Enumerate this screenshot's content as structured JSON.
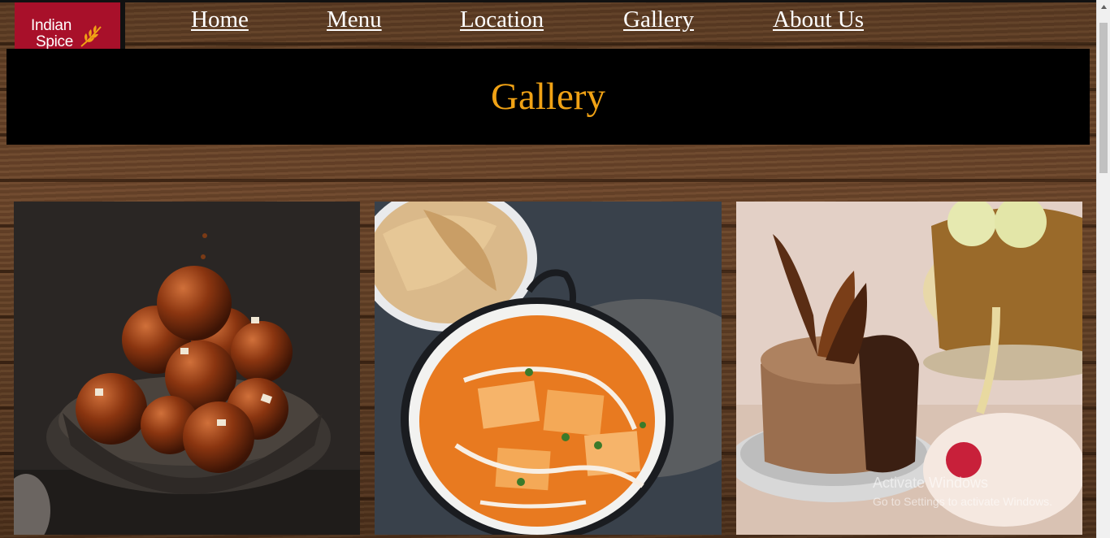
{
  "logo": {
    "line1": "Indian",
    "line2": "Spice"
  },
  "nav": {
    "items": [
      {
        "label": "Home"
      },
      {
        "label": "Menu"
      },
      {
        "label": "Location"
      },
      {
        "label": "Gallery"
      },
      {
        "label": "About Us"
      }
    ]
  },
  "page": {
    "title": "Gallery",
    "title_color": "#f0a215"
  },
  "gallery": {
    "images": [
      {
        "subject": "gulab-jamun"
      },
      {
        "subject": "paneer-curry-with-roti"
      },
      {
        "subject": "chocolate-mousse-cake"
      }
    ]
  },
  "watermark": {
    "line1": "Activate Windows",
    "line2": "Go to Settings to activate Windows."
  },
  "colors": {
    "brand": "#a8102a",
    "banner": "#000000"
  }
}
